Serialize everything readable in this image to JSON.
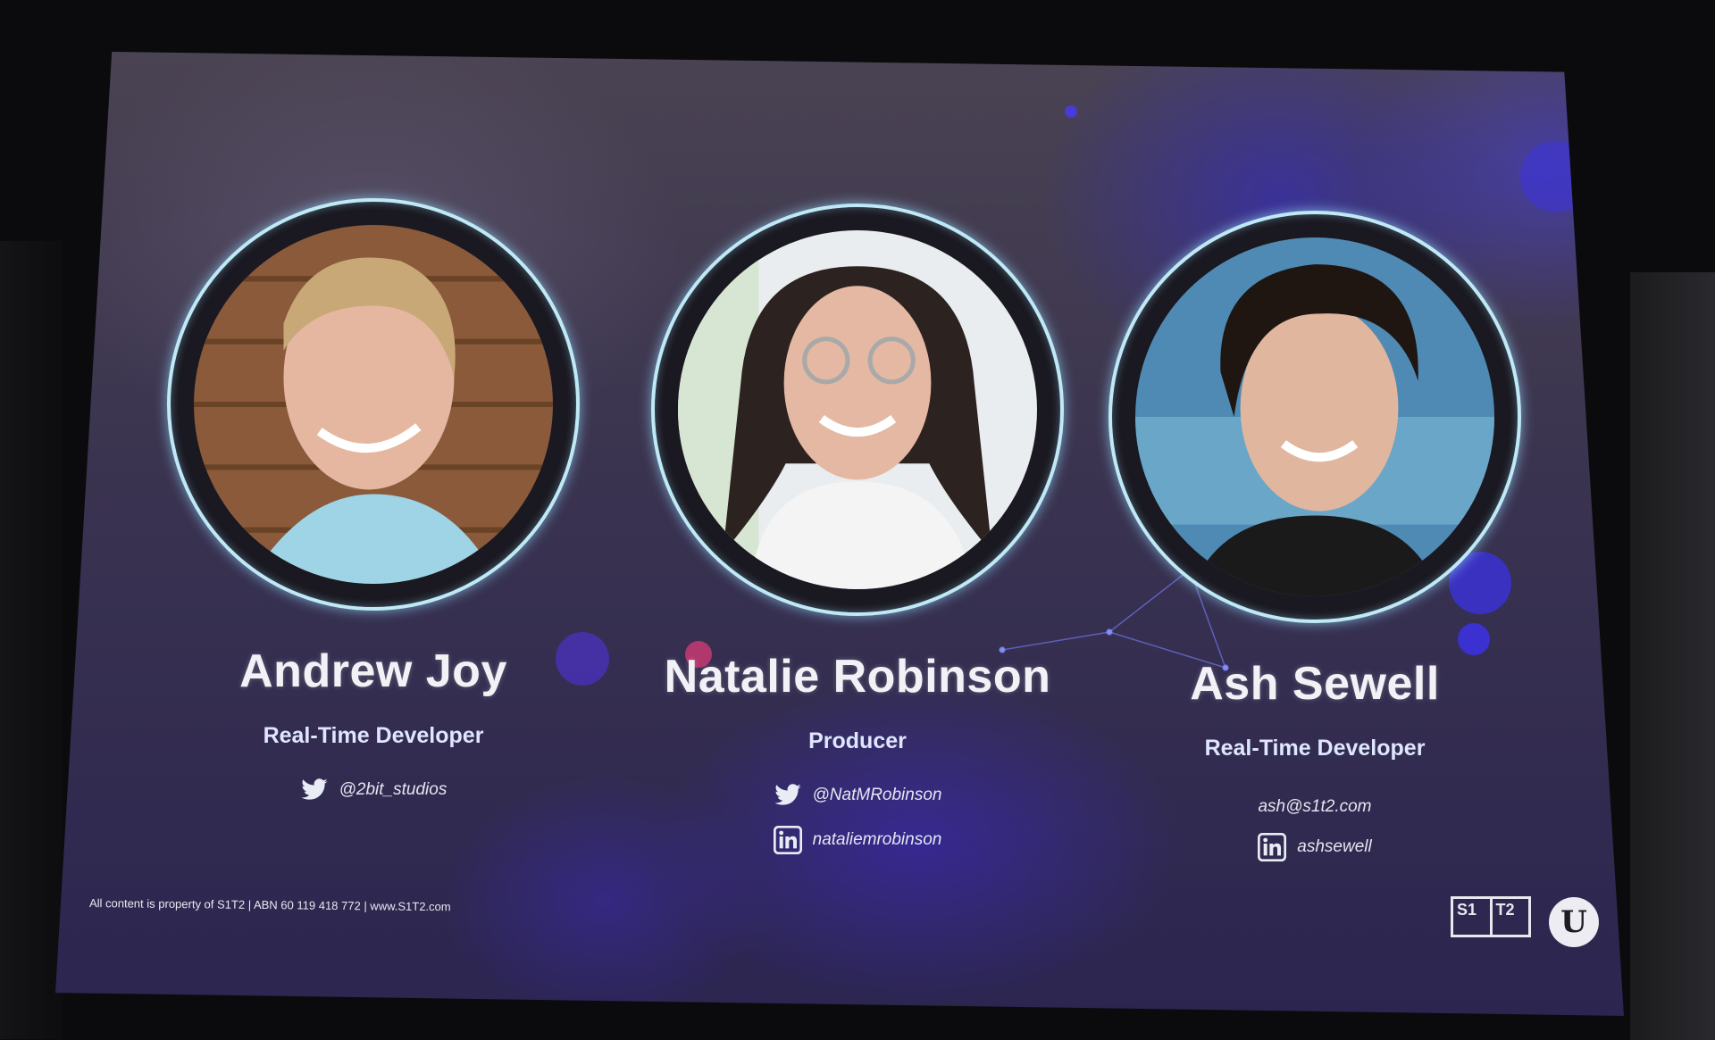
{
  "people": [
    {
      "name": "Andrew Joy",
      "role": "Real-Time Developer",
      "contacts": [
        {
          "icon": "twitter-icon",
          "text": "@2bit_studios"
        }
      ]
    },
    {
      "name": "Natalie Robinson",
      "role": "Producer",
      "contacts": [
        {
          "icon": "twitter-icon",
          "text": "@NatMRobinson"
        },
        {
          "icon": "linkedin-icon",
          "text": "nataliemrobinson"
        }
      ]
    },
    {
      "name": "Ash Sewell",
      "role": "Real-Time Developer",
      "contacts": [
        {
          "icon": "",
          "text": "ash@s1t2.com"
        },
        {
          "icon": "linkedin-icon",
          "text": "ashsewell"
        }
      ]
    }
  ],
  "footer": {
    "legal": "All content is property of S1T2 | ABN 60 119 418 772 | www.S1T2.com",
    "logo_left": "S1",
    "logo_right": "T2",
    "unreal_glyph": "U"
  },
  "colors": {
    "ring": "#bfe9f4",
    "text": "#f2f2f6",
    "accent_blue": "#3c2cd0"
  }
}
